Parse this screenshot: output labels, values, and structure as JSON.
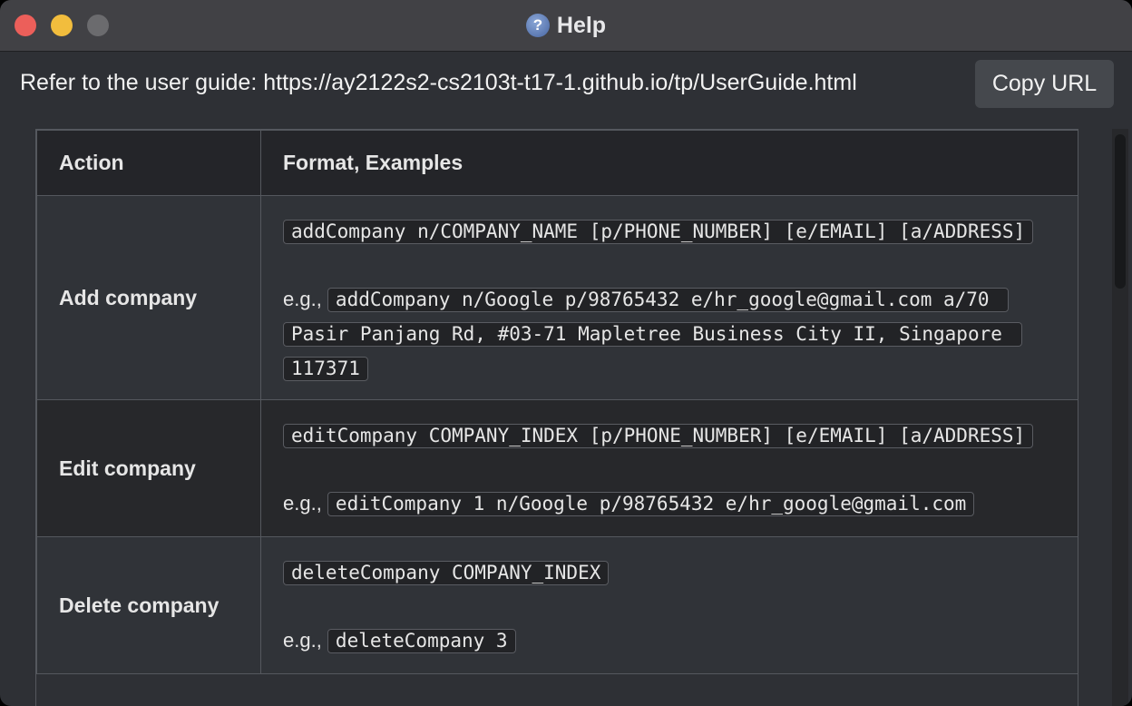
{
  "window": {
    "title": "Help"
  },
  "header": {
    "guide_text": "Refer to the user guide: https://ay2122s2-cs2103t-t17-1.github.io/tp/UserGuide.html",
    "copy_button": "Copy URL"
  },
  "table": {
    "headers": [
      "Action",
      "Format, Examples"
    ],
    "rows": [
      {
        "action": "Add company",
        "format": "addCompany n/COMPANY_NAME [p/PHONE_NUMBER] [e/EMAIL] [a/ADDRESS]",
        "example_prefix": "e.g., ",
        "example": "addCompany n/Google p/98765432 e/hr_google@gmail.com a/70 Pasir Panjang Rd, #03-71 Mapletree Business City II, Singapore 117371"
      },
      {
        "action": "Edit company",
        "format": "editCompany COMPANY_INDEX [p/PHONE_NUMBER] [e/EMAIL] [a/ADDRESS]",
        "example_prefix": "e.g., ",
        "example": "editCompany 1 n/Google p/98765432 e/hr_google@gmail.com"
      },
      {
        "action": "Delete company",
        "format": "deleteCompany COMPANY_INDEX",
        "example_prefix": "e.g., ",
        "example": "deleteCompany 3"
      }
    ]
  }
}
